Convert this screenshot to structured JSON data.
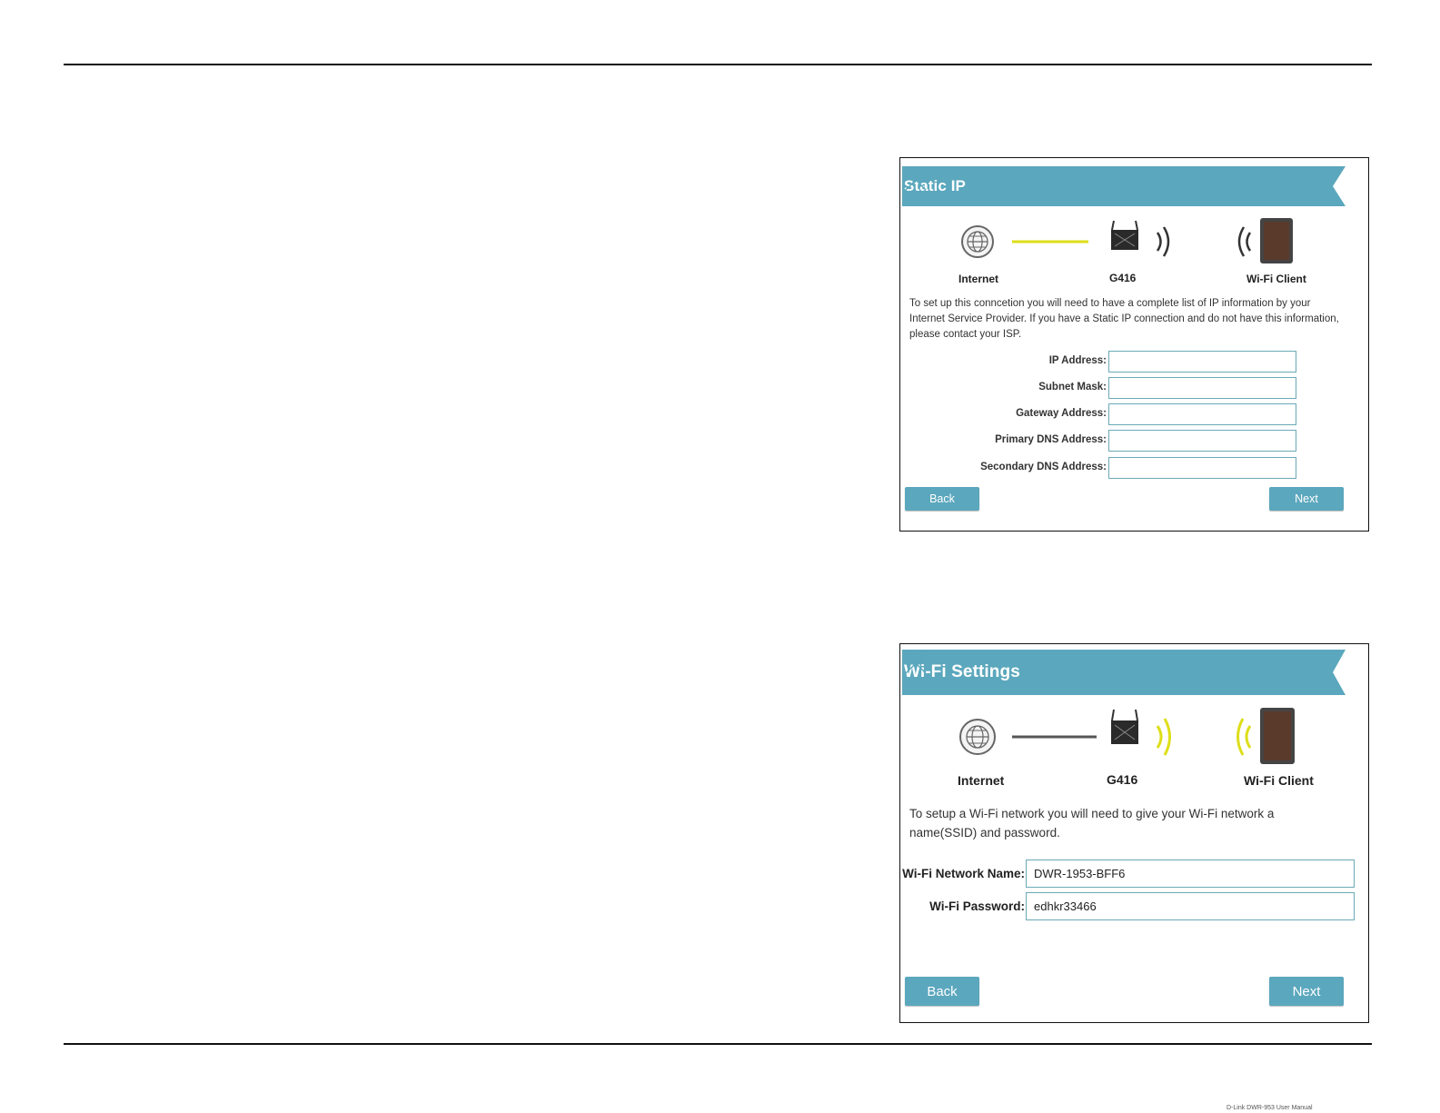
{
  "colors": {
    "banner": "#5ba7bd",
    "active_link": "#dede1a",
    "inactive_link": "#555555",
    "button": "#5ba7bd"
  },
  "static_ip": {
    "title": "Static IP",
    "diagram": {
      "internet_label": "Internet",
      "router_label": "G416",
      "client_label": "Wi-Fi Client",
      "active_segment": "internet-link"
    },
    "description": "To set up this conncetion you will need to have a complete list of IP information by your Internet Service Provider. If you have a Static IP connection and do not have this information, please contact your ISP.",
    "fields": [
      {
        "label": "IP Address:",
        "value": ""
      },
      {
        "label": "Subnet Mask:",
        "value": ""
      },
      {
        "label": "Gateway Address:",
        "value": ""
      },
      {
        "label": "Primary DNS Address:",
        "value": ""
      },
      {
        "label": "Secondary DNS Address:",
        "value": ""
      }
    ],
    "back_label": "Back",
    "next_label": "Next"
  },
  "wifi_settings": {
    "title": "Wi-Fi Settings",
    "diagram": {
      "internet_label": "Internet",
      "router_label": "G416",
      "client_label": "Wi-Fi Client",
      "active_segment": "wireless-link"
    },
    "description": "To setup a Wi-Fi network you will need to give your Wi-Fi network a name(SSID) and password.",
    "fields": [
      {
        "label": "Wi-Fi Network Name:",
        "value": "DWR-1953-BFF6"
      },
      {
        "label": "Wi-Fi Password:",
        "value": "edhkr33466"
      }
    ],
    "back_label": "Back",
    "next_label": "Next"
  },
  "footer_text": "D-Link DWR-953 User Manual"
}
